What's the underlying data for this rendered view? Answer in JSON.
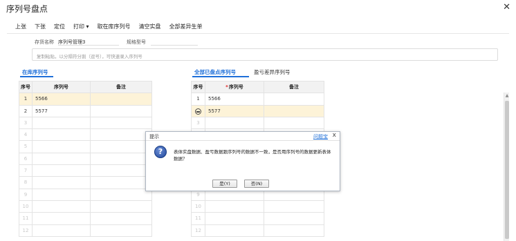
{
  "window": {
    "title": "序列号盘点",
    "close_glyph": "✕"
  },
  "toolbar": [
    "上张",
    "下张",
    "定位",
    "打印 ▾",
    "取在库序列号",
    "清空实盘",
    "全部差异生单"
  ],
  "fields": {
    "inventory_name_label": "存货名称",
    "inventory_name_value": "序列号管理3",
    "spec_label": "规格型号",
    "spec_value": ""
  },
  "paste_input": {
    "placeholder": "复制粘贴，以分隔符分割（逗号），可快速录入序列号"
  },
  "left_panel": {
    "tab": "在库序列号",
    "columns": [
      "序号",
      "序列号",
      "备注"
    ],
    "rows": [
      {
        "no": "1",
        "serial": "5566",
        "note": ""
      },
      {
        "no": "2",
        "serial": "5577",
        "note": ""
      },
      {
        "no": "3",
        "serial": "",
        "note": ""
      },
      {
        "no": "4",
        "serial": "",
        "note": ""
      },
      {
        "no": "5",
        "serial": "",
        "note": ""
      },
      {
        "no": "6",
        "serial": "",
        "note": ""
      },
      {
        "no": "7",
        "serial": "",
        "note": ""
      },
      {
        "no": "8",
        "serial": "",
        "note": ""
      },
      {
        "no": "9",
        "serial": "",
        "note": ""
      },
      {
        "no": "10",
        "serial": "",
        "note": ""
      },
      {
        "no": "11",
        "serial": "",
        "note": ""
      },
      {
        "no": "12",
        "serial": "",
        "note": ""
      }
    ]
  },
  "right_panel": {
    "tabs": [
      "全部已盘点序列号",
      "盈亏差异序列号"
    ],
    "columns": [
      "序号",
      "序列号",
      "备注"
    ],
    "required_mark": "*",
    "rows": [
      {
        "no": "1",
        "serial": "5566",
        "note": ""
      },
      {
        "no": "",
        "serial": "5577",
        "note": ""
      },
      {
        "no": "3",
        "serial": "",
        "note": ""
      },
      {
        "no": "4",
        "serial": "",
        "note": ""
      },
      {
        "no": "5",
        "serial": "",
        "note": ""
      },
      {
        "no": "6",
        "serial": "",
        "note": ""
      },
      {
        "no": "7",
        "serial": "",
        "note": ""
      },
      {
        "no": "8",
        "serial": "",
        "note": ""
      },
      {
        "no": "9",
        "serial": "",
        "note": ""
      },
      {
        "no": "10",
        "serial": "",
        "note": ""
      },
      {
        "no": "11",
        "serial": "",
        "note": ""
      },
      {
        "no": "12",
        "serial": "",
        "note": ""
      }
    ]
  },
  "dialog": {
    "title": "提示",
    "help": "问题宝",
    "close": "x",
    "icon": "question-icon",
    "message": "表体实盘数据、盈亏数据跟序列号的数据不一致，是否用序列号的数据更新表体数据？",
    "yes": "是(Y)",
    "no": "否(N)"
  },
  "colors": {
    "accent": "#1e6fd9",
    "selected_row": "#fdf3d8",
    "header_bg": "#f2f2f2",
    "required": "#e02020"
  }
}
